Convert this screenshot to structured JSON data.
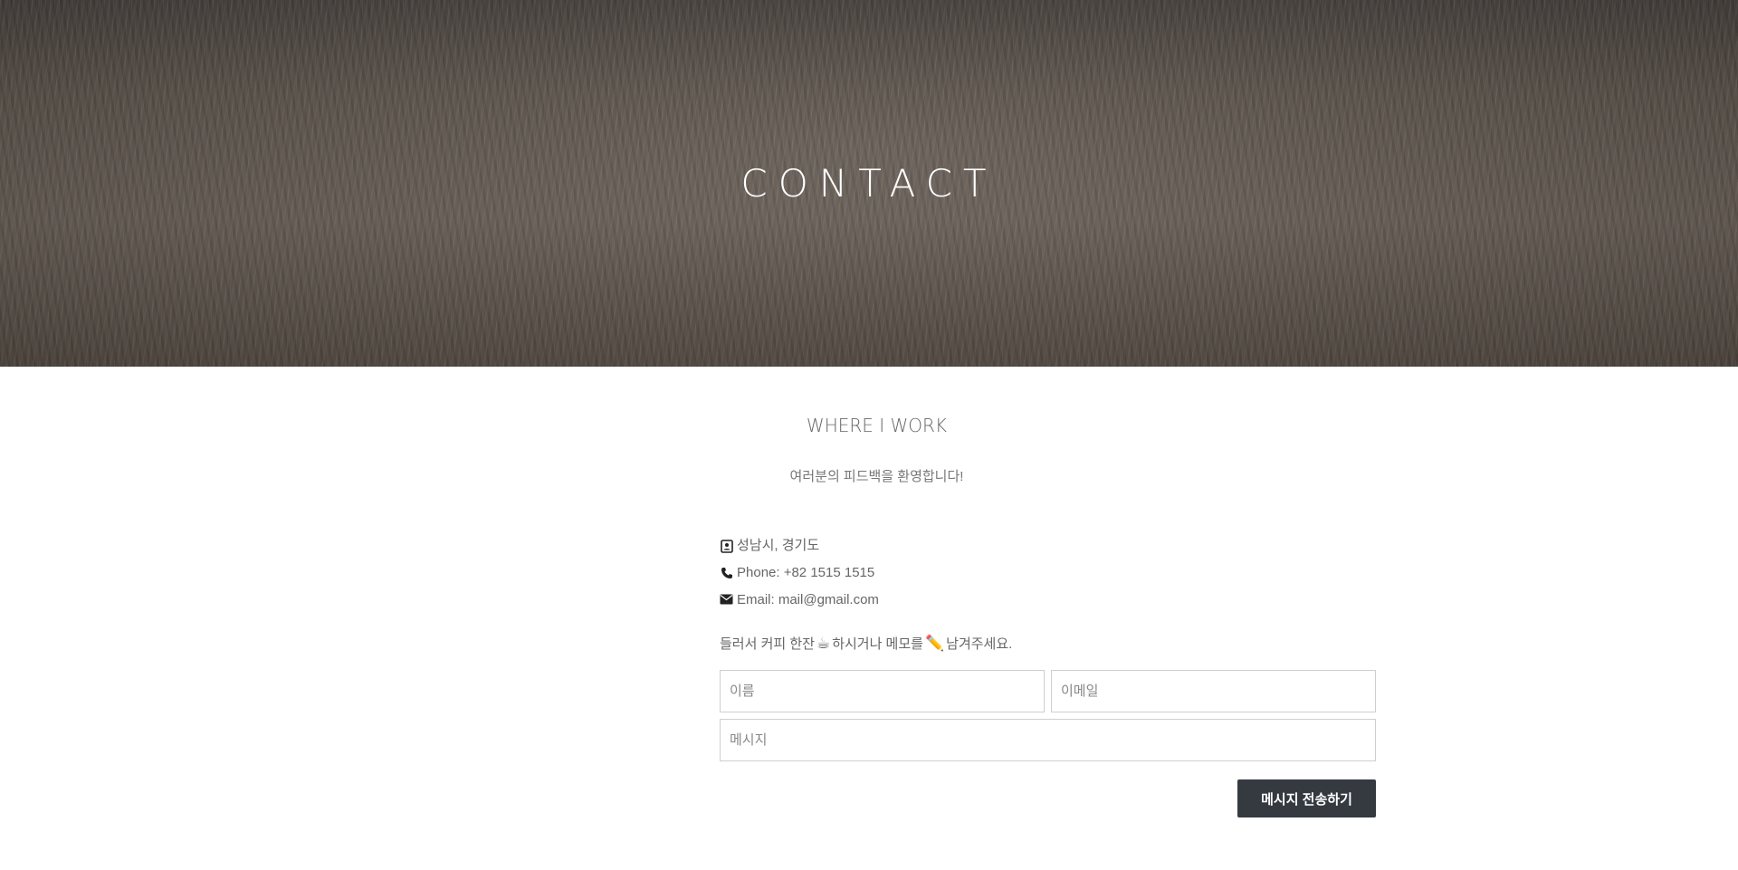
{
  "hero": {
    "title": "CONTACT"
  },
  "section": {
    "title": "WHERE I WORK",
    "subtitle": "여러분의 피드백을 환영합니다!"
  },
  "contact_info": {
    "address": "성남시, 경기도",
    "phone": "Phone: +82 1515 1515",
    "email": "Email: mail@gmail.com",
    "address_icon": "address-card-icon",
    "phone_icon": "phone-icon",
    "email_icon": "envelope-icon"
  },
  "invite": {
    "part1": "들러서 커피 한잔",
    "part2": " 하시거나 메모를",
    "part3": " 남겨주세요.",
    "coffee_emoji": "☕",
    "pencil_emoji": "✏️"
  },
  "form": {
    "name_placeholder": "이름",
    "email_placeholder": "이메일",
    "message_placeholder": "메시지",
    "submit_label": "메시지 전송하기"
  },
  "colors": {
    "button_bg": "#343a40",
    "button_text": "#ffffff",
    "hero_text": "#ffffff"
  }
}
